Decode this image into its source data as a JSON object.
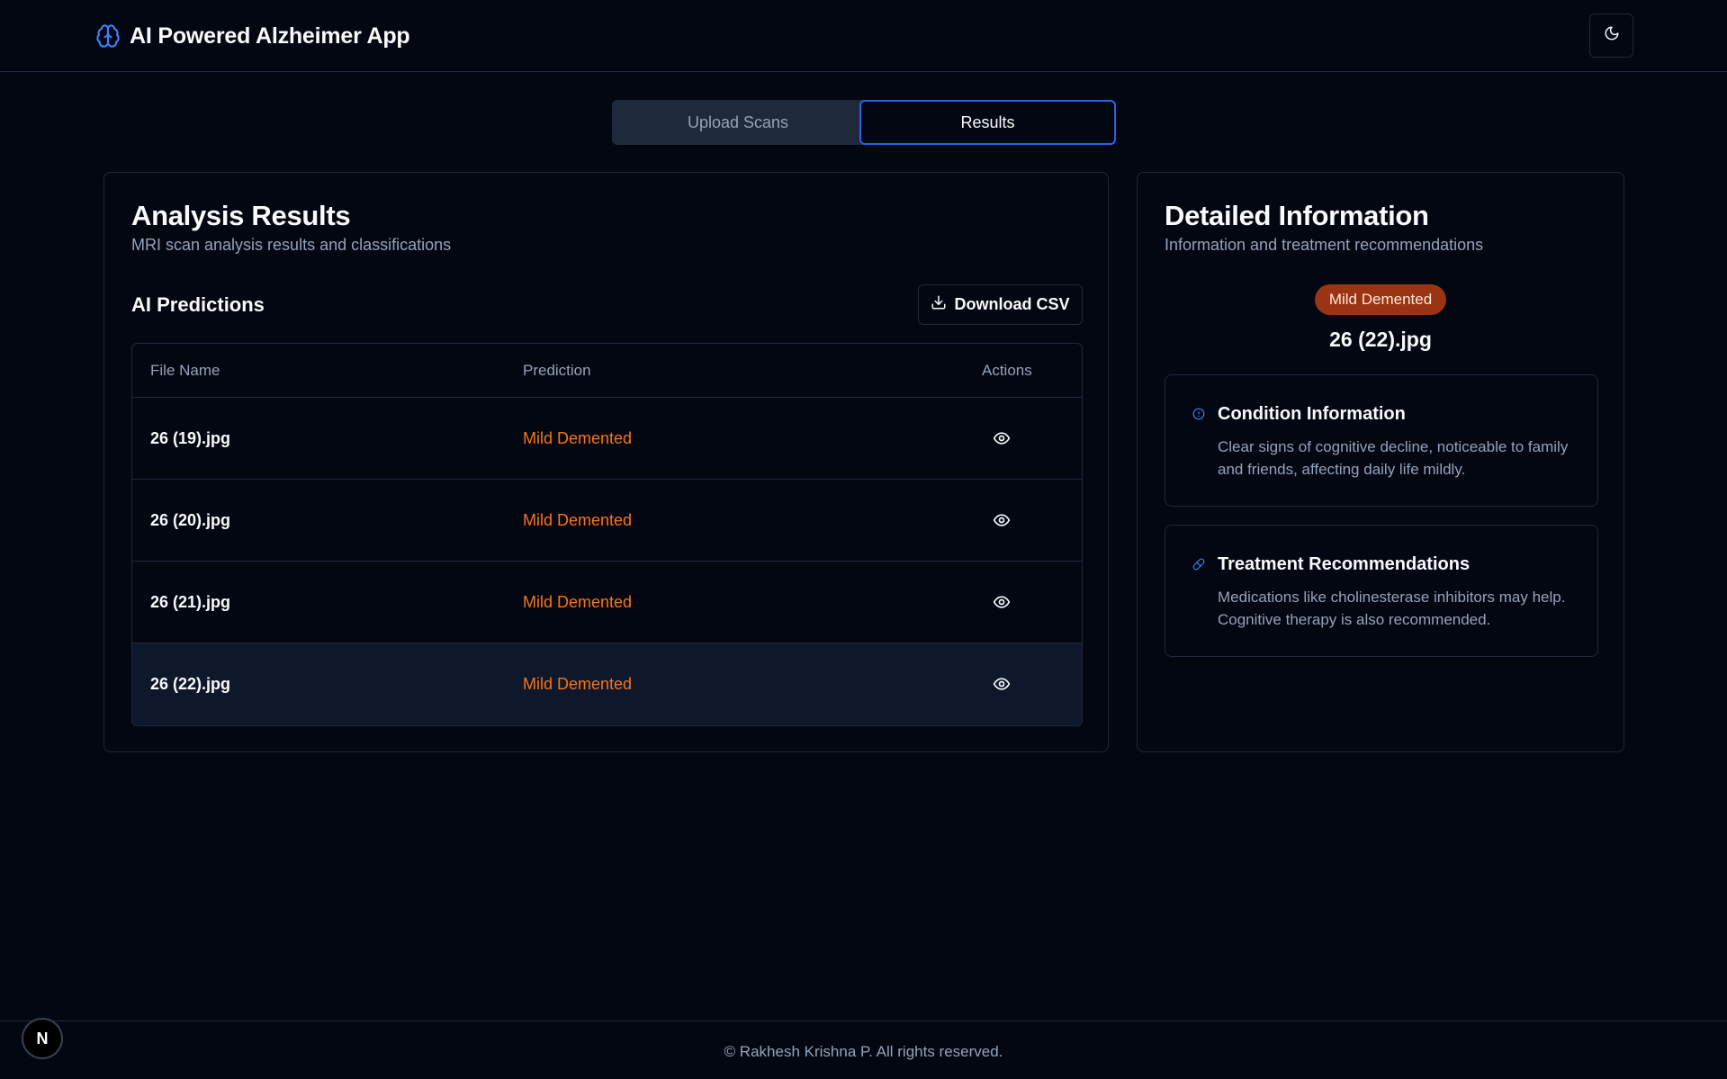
{
  "app": {
    "title": "AI Powered Alzheimer App"
  },
  "header": {
    "theme_toggle_icon": "moon-icon",
    "brand_icon": "brain-icon"
  },
  "tabs": [
    {
      "label": "Upload Scans",
      "active": false
    },
    {
      "label": "Results",
      "active": true
    }
  ],
  "results": {
    "title": "Analysis Results",
    "subtitle": "MRI scan analysis results and classifications",
    "section_title": "AI Predictions",
    "download_label": "Download CSV",
    "columns": {
      "file": "File Name",
      "prediction": "Prediction",
      "actions": "Actions"
    },
    "rows": [
      {
        "file": "26 (19).jpg",
        "prediction": "Mild Demented"
      },
      {
        "file": "26 (20).jpg",
        "prediction": "Mild Demented"
      },
      {
        "file": "26 (21).jpg",
        "prediction": "Mild Demented"
      },
      {
        "file": "26 (22).jpg",
        "prediction": "Mild Demented"
      }
    ],
    "selected_row": 3
  },
  "details": {
    "title": "Detailed Information",
    "subtitle": "Information and treatment recommendations",
    "badge": "Mild Demented",
    "file": "26 (22).jpg",
    "condition": {
      "title": "Condition Information",
      "text": "Clear signs of cognitive decline, noticeable to family and friends, affecting daily life mildly."
    },
    "treatment": {
      "title": "Treatment Recommendations",
      "text": "Medications like cholinesterase inhibitors may help. Cognitive therapy is also recommended."
    }
  },
  "footer": {
    "text": "© Rakhesh Krishna P. All rights reserved."
  },
  "dev_badge": {
    "label": "N"
  },
  "colors": {
    "background": "#030712",
    "accent": "#2563eb",
    "prediction": "#f97316",
    "badge_bg": "#9a3412",
    "muted": "#94a3b8"
  }
}
